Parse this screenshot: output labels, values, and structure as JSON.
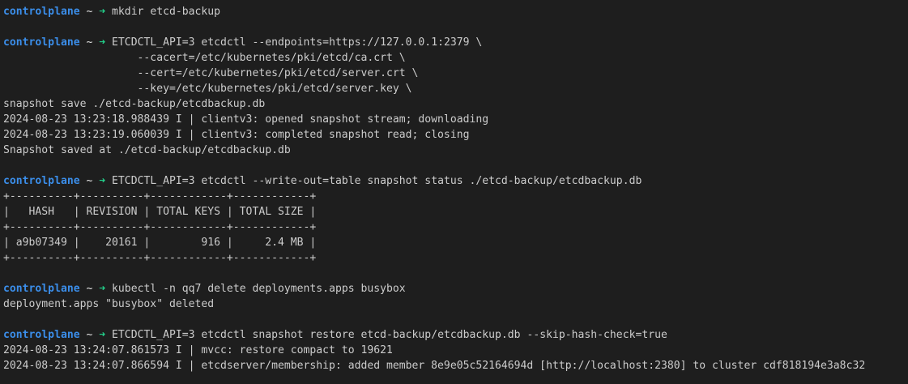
{
  "terminal": {
    "prompt": {
      "host": "controlplane",
      "separator": " ~ ",
      "arrow": "➜"
    },
    "colors": {
      "background": "#1e1e1e",
      "text": "#cccccc",
      "host": "#3b8eea",
      "arrow": "#23d18b"
    },
    "lines": [
      {
        "kind": "prompt",
        "text": " mkdir etcd-backup"
      },
      {
        "kind": "blank",
        "text": ""
      },
      {
        "kind": "prompt",
        "text": " ETCDCTL_API=3 etcdctl --endpoints=https://127.0.0.1:2379 \\"
      },
      {
        "kind": "output",
        "text": "                     --cacert=/etc/kubernetes/pki/etcd/ca.crt \\"
      },
      {
        "kind": "output",
        "text": "                     --cert=/etc/kubernetes/pki/etcd/server.crt \\"
      },
      {
        "kind": "output",
        "text": "                     --key=/etc/kubernetes/pki/etcd/server.key \\"
      },
      {
        "kind": "output",
        "text": "snapshot save ./etcd-backup/etcdbackup.db"
      },
      {
        "kind": "output",
        "text": "2024-08-23 13:23:18.988439 I | clientv3: opened snapshot stream; downloading"
      },
      {
        "kind": "output",
        "text": "2024-08-23 13:23:19.060039 I | clientv3: completed snapshot read; closing"
      },
      {
        "kind": "output",
        "text": "Snapshot saved at ./etcd-backup/etcdbackup.db"
      },
      {
        "kind": "blank",
        "text": ""
      },
      {
        "kind": "prompt",
        "text": " ETCDCTL_API=3 etcdctl --write-out=table snapshot status ./etcd-backup/etcdbackup.db"
      },
      {
        "kind": "output",
        "text": "+----------+----------+------------+------------+"
      },
      {
        "kind": "output",
        "text": "|   HASH   | REVISION | TOTAL KEYS | TOTAL SIZE |"
      },
      {
        "kind": "output",
        "text": "+----------+----------+------------+------------+"
      },
      {
        "kind": "output",
        "text": "| a9b07349 |    20161 |        916 |     2.4 MB |"
      },
      {
        "kind": "output",
        "text": "+----------+----------+------------+------------+"
      },
      {
        "kind": "blank",
        "text": ""
      },
      {
        "kind": "prompt",
        "text": " kubectl -n qq7 delete deployments.apps busybox"
      },
      {
        "kind": "output",
        "text": "deployment.apps \"busybox\" deleted"
      },
      {
        "kind": "blank",
        "text": ""
      },
      {
        "kind": "prompt",
        "text": " ETCDCTL_API=3 etcdctl snapshot restore etcd-backup/etcdbackup.db --skip-hash-check=true"
      },
      {
        "kind": "output",
        "text": "2024-08-23 13:24:07.861573 I | mvcc: restore compact to 19621"
      },
      {
        "kind": "output",
        "text": "2024-08-23 13:24:07.866594 I | etcdserver/membership: added member 8e9e05c52164694d [http://localhost:2380] to cluster cdf818194e3a8c32"
      }
    ]
  }
}
